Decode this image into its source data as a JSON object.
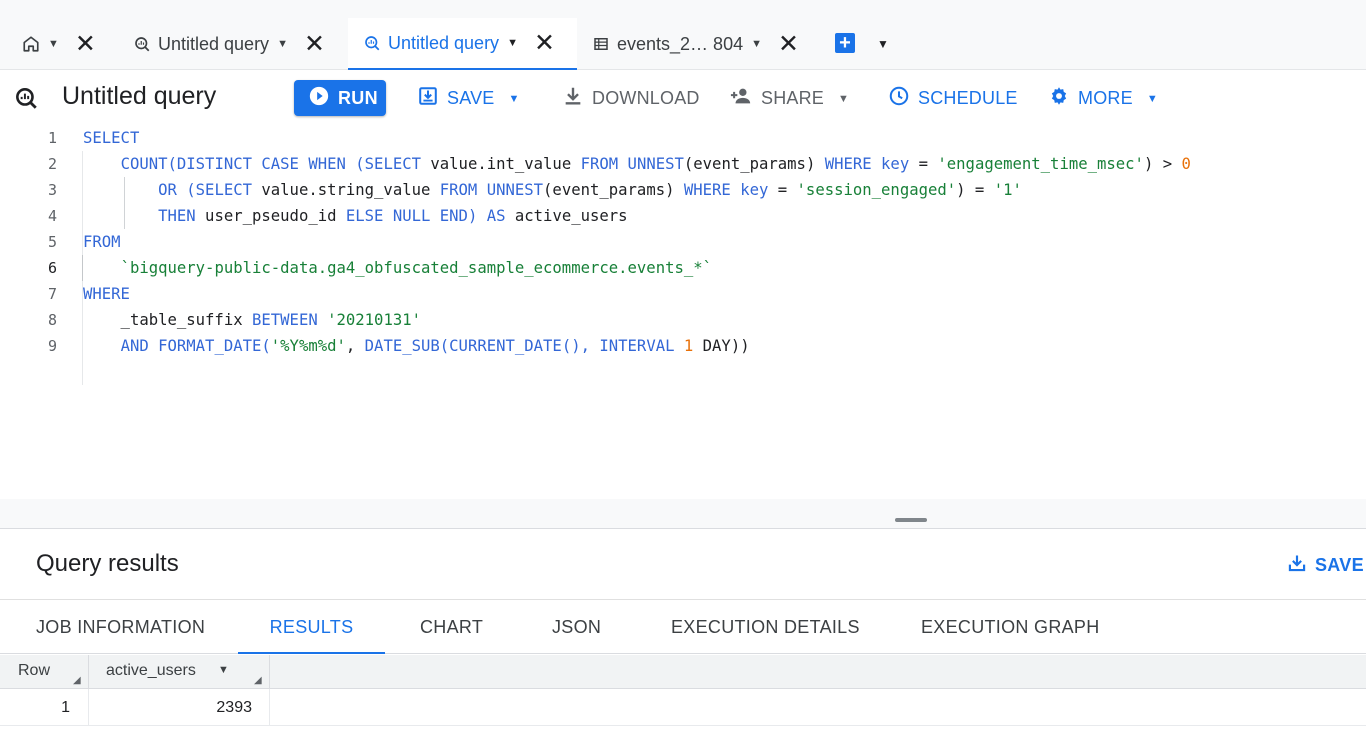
{
  "tabs": {
    "items": [
      {
        "label": "Untitled query"
      },
      {
        "label": "Untitled query"
      },
      {
        "label": "events_2… 804"
      }
    ]
  },
  "toolbar": {
    "title": "Untitled query",
    "run_label": "RUN",
    "save_label": "SAVE",
    "download_label": "DOWNLOAD",
    "share_label": "SHARE",
    "schedule_label": "SCHEDULE",
    "more_label": "MORE"
  },
  "editor": {
    "line_numbers": [
      "1",
      "2",
      "3",
      "4",
      "5",
      "6",
      "7",
      "8",
      "9"
    ],
    "active_line": 6,
    "lines": [
      [
        {
          "t": "SELECT",
          "c": "kw"
        }
      ],
      [
        {
          "t": "    "
        },
        {
          "t": "COUNT(DISTINCT CASE WHEN",
          "c": "kw"
        },
        {
          "t": " "
        },
        {
          "t": "(SELECT",
          "c": "kw"
        },
        {
          "t": " value.int_value "
        },
        {
          "t": "FROM UNNEST",
          "c": "kw"
        },
        {
          "t": "(event_params) "
        },
        {
          "t": "WHERE key",
          "c": "kw"
        },
        {
          "t": " = "
        },
        {
          "t": "'engagement_time_msec'",
          "c": "str"
        },
        {
          "t": ") > "
        },
        {
          "t": "0",
          "c": "num"
        }
      ],
      [
        {
          "t": "        "
        },
        {
          "t": "OR",
          "c": "kw"
        },
        {
          "t": " "
        },
        {
          "t": "(SELECT",
          "c": "kw"
        },
        {
          "t": " value.string_value "
        },
        {
          "t": "FROM UNNEST",
          "c": "kw"
        },
        {
          "t": "(event_params) "
        },
        {
          "t": "WHERE key",
          "c": "kw"
        },
        {
          "t": " = "
        },
        {
          "t": "'session_engaged'",
          "c": "str"
        },
        {
          "t": ") = "
        },
        {
          "t": "'1'",
          "c": "str"
        }
      ],
      [
        {
          "t": "        "
        },
        {
          "t": "THEN",
          "c": "kw"
        },
        {
          "t": " user_pseudo_id "
        },
        {
          "t": "ELSE NULL END)",
          "c": "kw"
        },
        {
          "t": " "
        },
        {
          "t": "AS",
          "c": "kw"
        },
        {
          "t": " active_users"
        }
      ],
      [
        {
          "t": "FROM",
          "c": "kw"
        }
      ],
      [
        {
          "t": "    "
        },
        {
          "t": "`bigquery-public-data.ga4_obfuscated_sample_ecommerce.events_*`",
          "c": "str"
        }
      ],
      [
        {
          "t": "WHERE",
          "c": "kw"
        }
      ],
      [
        {
          "t": "    _table_suffix "
        },
        {
          "t": "BETWEEN",
          "c": "kw"
        },
        {
          "t": " "
        },
        {
          "t": "'20210131'",
          "c": "str"
        }
      ],
      [
        {
          "t": "    "
        },
        {
          "t": "AND FORMAT_DATE(",
          "c": "kw"
        },
        {
          "t": "'%Y%m%d'",
          "c": "str"
        },
        {
          "t": ", "
        },
        {
          "t": "DATE_SUB(CURRENT_DATE(), INTERVAL",
          "c": "kw"
        },
        {
          "t": " "
        },
        {
          "t": "1",
          "c": "num"
        },
        {
          "t": " DAY))"
        }
      ]
    ]
  },
  "results": {
    "title": "Query results",
    "save_label": "SAVE",
    "tabs": [
      {
        "label": "JOB INFORMATION"
      },
      {
        "label": "RESULTS"
      },
      {
        "label": "CHART"
      },
      {
        "label": "JSON"
      },
      {
        "label": "EXECUTION DETAILS"
      },
      {
        "label": "EXECUTION GRAPH"
      }
    ],
    "active_tab": "RESULTS",
    "columns": [
      "Row",
      "active_users"
    ],
    "rows": [
      {
        "row": "1",
        "active_users": "2393"
      }
    ]
  },
  "colors": {
    "accent": "#1a73e8",
    "keyword": "#3367d6",
    "string": "#188038",
    "number": "#e8710a"
  }
}
